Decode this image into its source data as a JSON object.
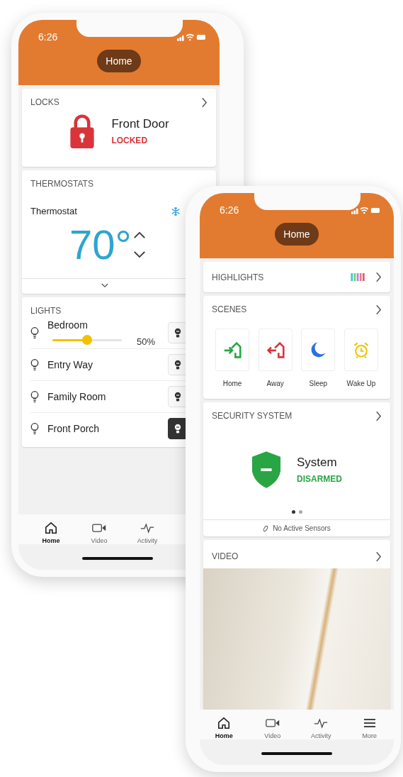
{
  "back_phone": {
    "time": "6:26",
    "title": "Home",
    "locks": {
      "heading": "LOCKS",
      "name": "Front Door",
      "status": "LOCKED"
    },
    "thermostats": {
      "heading": "THERMOSTATS",
      "name": "Thermostat",
      "temperature": "70°"
    },
    "lights": {
      "heading": "LIGHTS",
      "items": [
        {
          "kind": "dimmer",
          "name": "Bedroom",
          "level": 0.5,
          "reading": "50%",
          "on": false
        },
        {
          "kind": "switch",
          "name": "Entry Way",
          "on": false
        },
        {
          "kind": "switch",
          "name": "Family Room",
          "on": false
        },
        {
          "kind": "switch",
          "name": "Front Porch",
          "on": true
        }
      ]
    },
    "tabs": [
      {
        "label": "Home",
        "selected": true
      },
      {
        "label": "Video",
        "selected": false
      },
      {
        "label": "Activity",
        "selected": false
      }
    ]
  },
  "front_phone": {
    "time": "6:26",
    "title": "Home",
    "highlights": {
      "heading": "HIGHLIGHTS"
    },
    "scenes": {
      "heading": "SCENES",
      "items": [
        {
          "kind": "home",
          "label": "Home"
        },
        {
          "kind": "away",
          "label": "Away"
        },
        {
          "kind": "sleep",
          "label": "Sleep"
        },
        {
          "kind": "wake",
          "label": "Wake Up"
        }
      ]
    },
    "security": {
      "heading": "SECURITY SYSTEM",
      "name": "System",
      "status": "DISARMED",
      "pager": [
        {
          "selected": true
        },
        {
          "selected": false
        }
      ],
      "sensors": "No Active Sensors"
    },
    "video": {
      "heading": "VIDEO"
    },
    "tabs": [
      {
        "label": "Home",
        "selected": true
      },
      {
        "label": "Video",
        "selected": false
      },
      {
        "label": "Activity",
        "selected": false
      },
      {
        "label": "More",
        "selected": false
      }
    ]
  }
}
